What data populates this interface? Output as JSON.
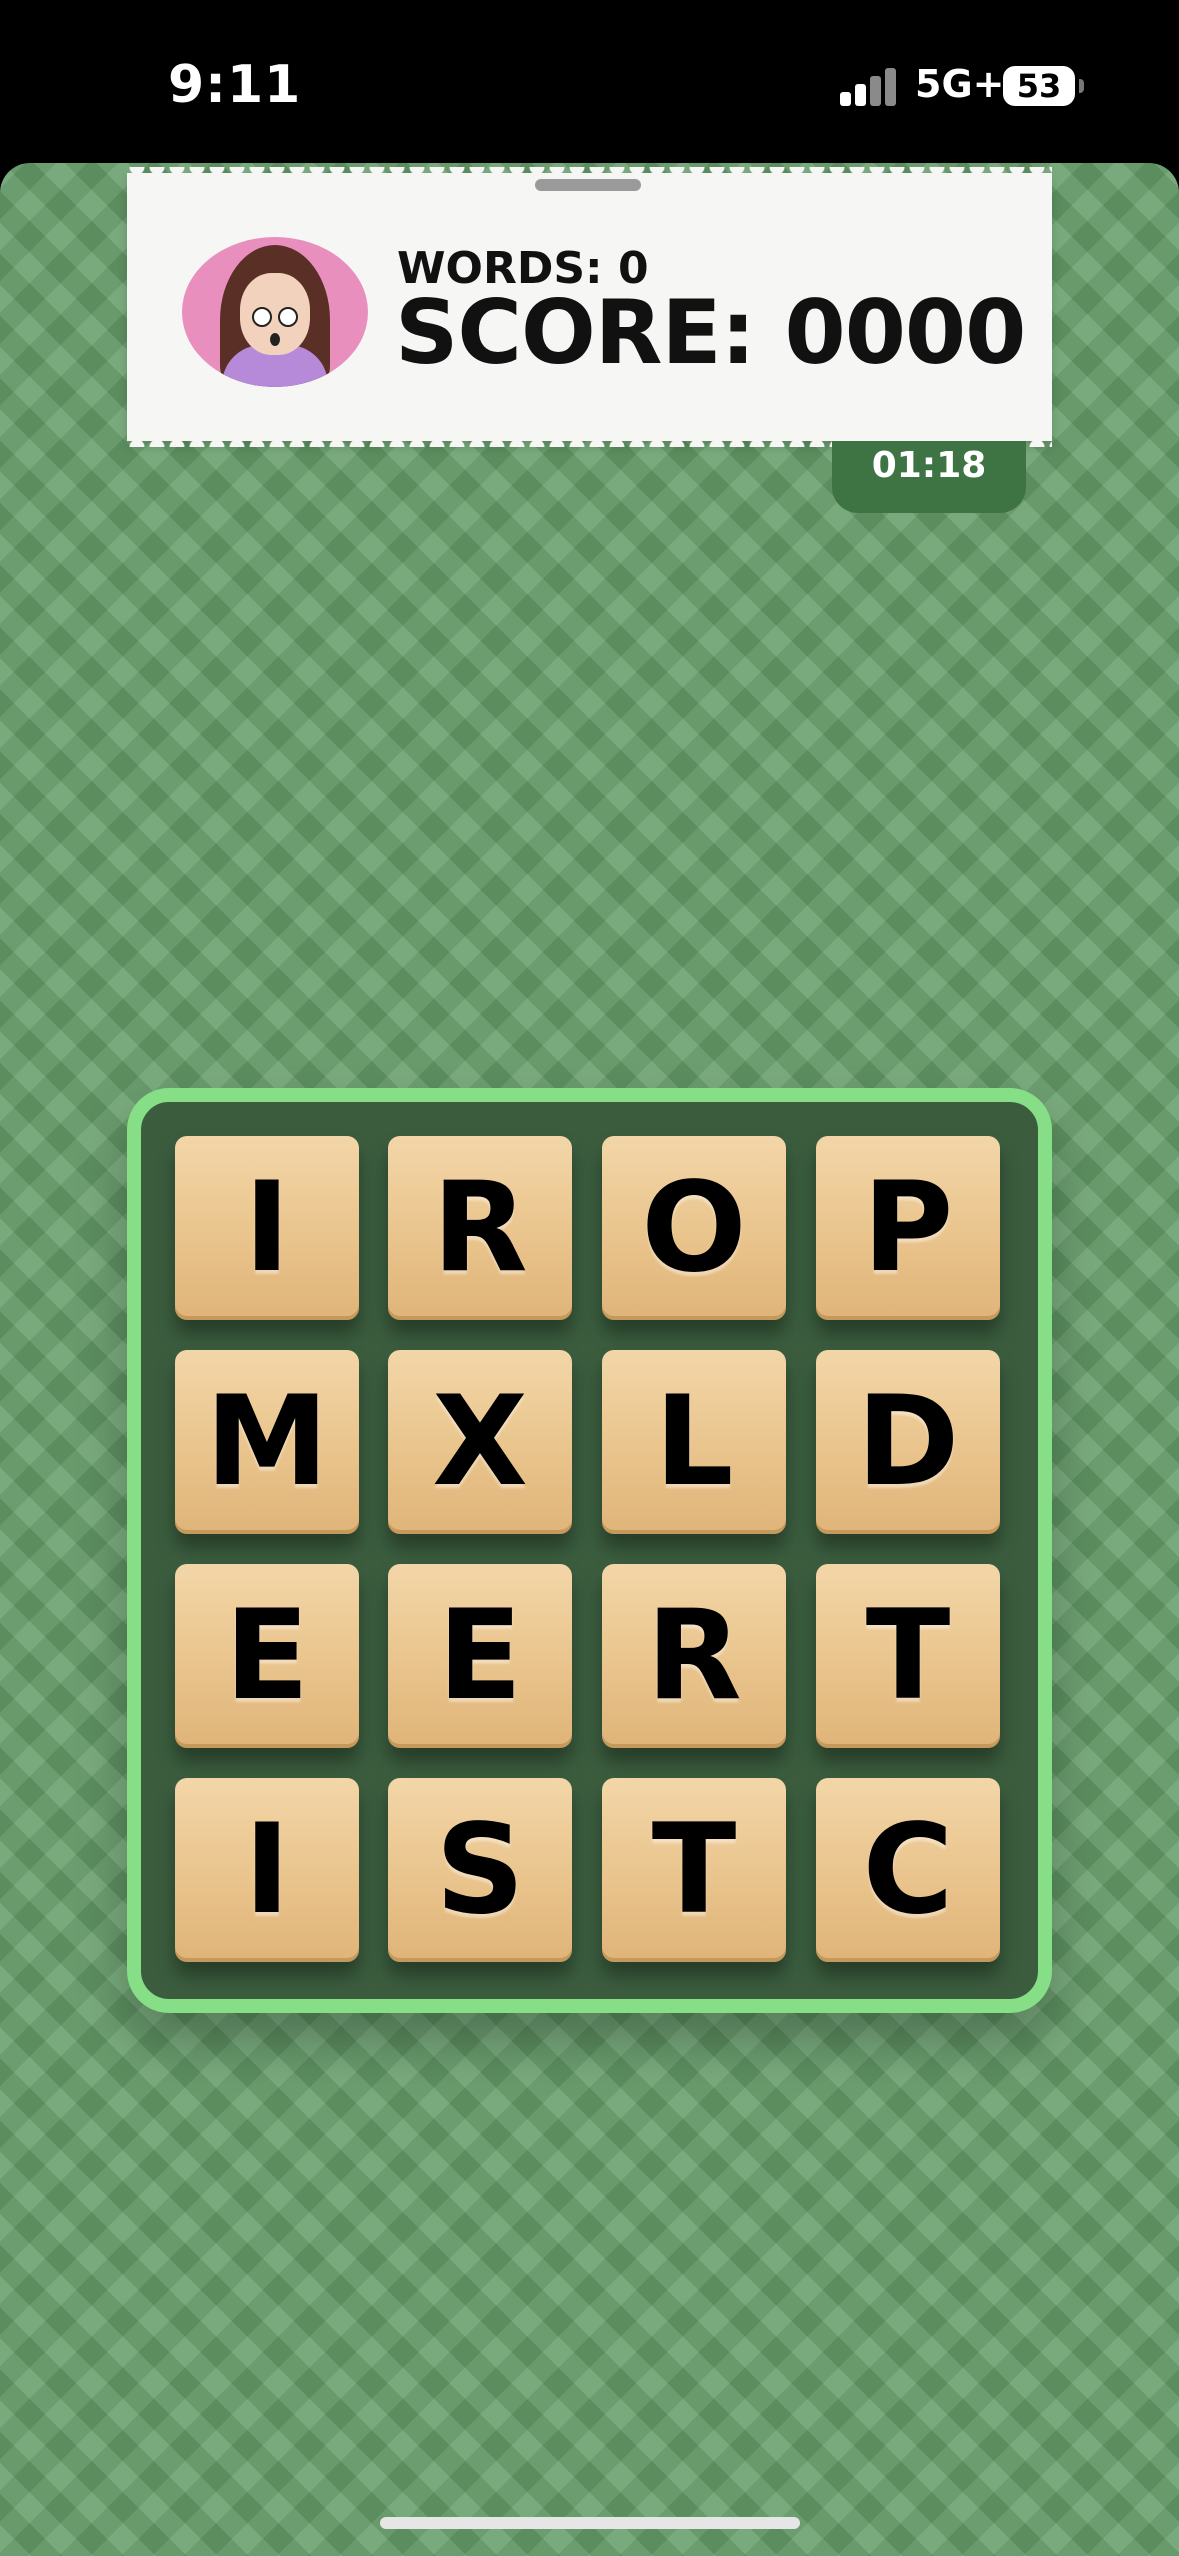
{
  "status_bar": {
    "time": "9:11",
    "network": "5G+",
    "battery": "53"
  },
  "header": {
    "words_label": "WORDS: 0",
    "score_label": "SCORE: 0000",
    "timer": "01:18"
  },
  "board": {
    "tiles": [
      "I",
      "R",
      "O",
      "P",
      "M",
      "X",
      "L",
      "D",
      "E",
      "E",
      "R",
      "T",
      "I",
      "S",
      "T",
      "C"
    ]
  },
  "colors": {
    "background": "#669e6a",
    "board_border": "#86de86",
    "board_fill": "#3b5d3e",
    "timer_bg": "#3e7443",
    "tile": "#e9c48c"
  },
  "icons": {
    "avatar": "player-avatar-icon",
    "signal": "cellular-signal-icon",
    "battery": "battery-icon"
  }
}
